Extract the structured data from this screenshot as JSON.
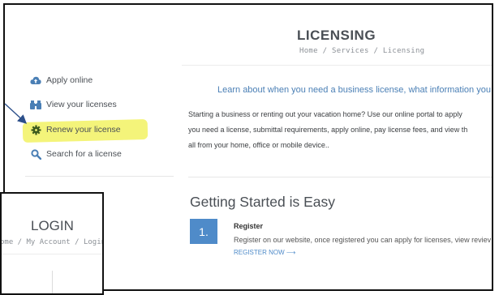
{
  "page": {
    "title": "LICENSING",
    "breadcrumb": "Home / Services / Licensing"
  },
  "sidebar": {
    "items": [
      {
        "label": "Apply online",
        "icon": "cloud-upload-icon"
      },
      {
        "label": "View your licenses",
        "icon": "binoculars-icon"
      },
      {
        "label": "Renew your license",
        "icon": "gear-icon"
      },
      {
        "label": "Search for a license",
        "icon": "search-icon"
      }
    ]
  },
  "main": {
    "intro": "Learn about when you need a business license, what information you",
    "paragraph_lines": [
      "Starting a business or renting out your vacation home? Use our online portal to apply",
      "you need a license, submittal requirements, apply online, pay license fees, and view th",
      "all from your home, office or mobile device.."
    ],
    "section_title": "Getting Started is Easy",
    "step": {
      "number": "1.",
      "title": "Register",
      "description": "Register on our website, once registered you can apply for licenses, view reviev",
      "link": "REGISTER NOW ⟶"
    }
  },
  "login_inset": {
    "title": "LOGIN",
    "breadcrumb": "ome / My Account / Login"
  },
  "colors": {
    "accent": "#4f8bc9",
    "highlight": "#f4f47a",
    "annotation_arrow": "#2c4f8a"
  }
}
